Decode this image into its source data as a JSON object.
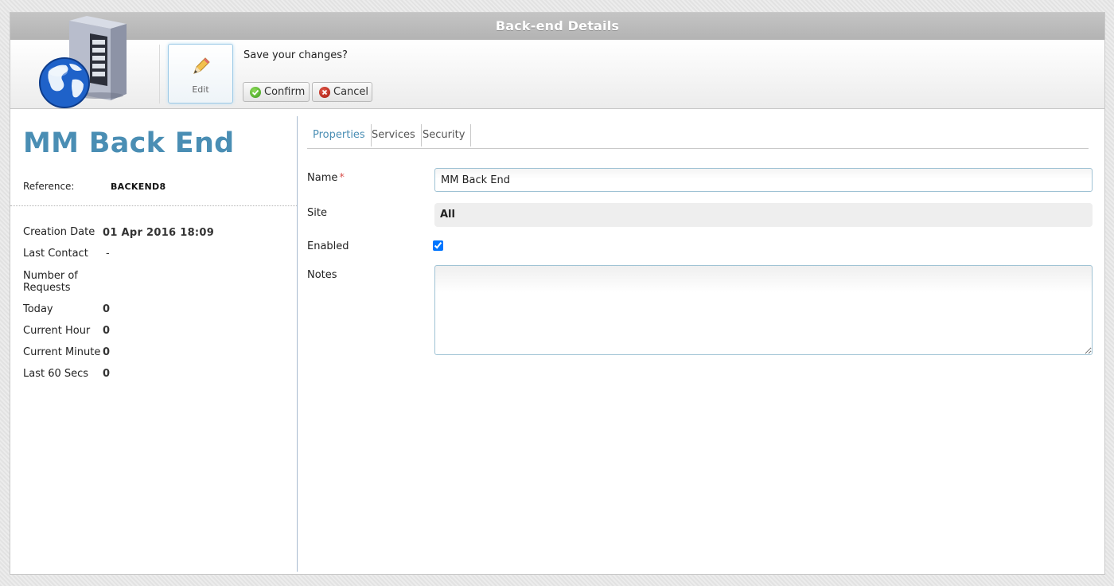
{
  "window": {
    "title": "Back-end Details"
  },
  "toolbar": {
    "edit_label": "Edit",
    "save_prompt": "Save your changes?",
    "confirm_label": "Confirm",
    "cancel_label": "Cancel"
  },
  "summary": {
    "title": "MM Back End",
    "reference_label": "Reference:",
    "reference_value": "BACKEND8",
    "stats": {
      "creation_date_label": "Creation Date",
      "creation_date_value": "01 Apr 2016 18:09",
      "last_contact_label": "Last Contact",
      "last_contact_value": "-",
      "requests_label_line1": "Number of",
      "requests_label_line2": "Requests",
      "today_label": "Today",
      "today_value": "0",
      "current_hour_label": "Current Hour",
      "current_hour_value": "0",
      "current_minute_label": "Current Minute",
      "current_minute_value": "0",
      "last_60_label": "Last 60 Secs",
      "last_60_value": "0"
    }
  },
  "tabs": {
    "properties": "Properties",
    "services": "Services",
    "security": "Security",
    "active": "Properties"
  },
  "form": {
    "name_label": "Name",
    "required_marker": "*",
    "name_value": "MM Back End",
    "site_label": "Site",
    "site_value": "All",
    "enabled_label": "Enabled",
    "enabled_checked": true,
    "notes_label": "Notes",
    "notes_value": ""
  },
  "colors": {
    "accent": "#4a8eb4",
    "titlebar": "#b8b8b8",
    "confirm_icon": "#3c9b1c",
    "cancel_icon": "#a7190d",
    "required": "#d9534f"
  },
  "icons": {
    "logo": "server-globe-icon",
    "edit": "pencil-icon",
    "confirm": "check-circle-icon",
    "cancel": "x-circle-icon"
  }
}
